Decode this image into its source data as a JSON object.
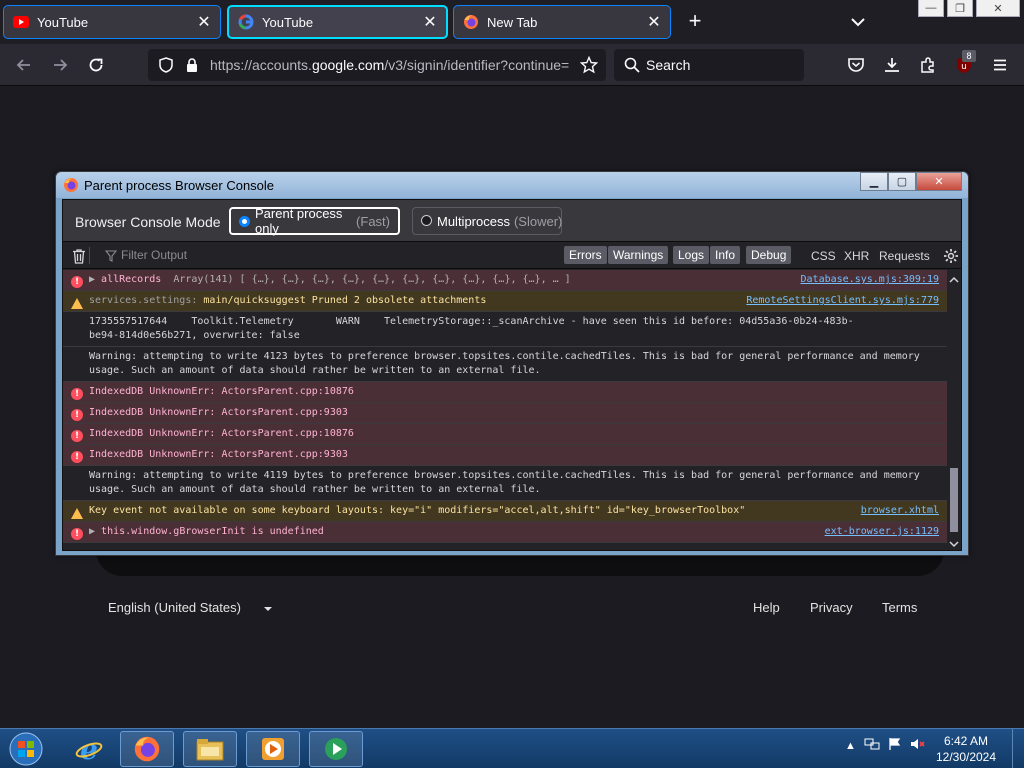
{
  "browser": {
    "tabs": [
      {
        "title": "YouTube",
        "icon": "youtube-icon"
      },
      {
        "title": "YouTube",
        "icon": "google-icon"
      },
      {
        "title": "New Tab",
        "icon": "firefox-icon"
      }
    ],
    "new_tab": "+",
    "url_prefix": "https://accounts.",
    "url_domain": "google.com",
    "url_suffix": "/v3/signin/identifier?continue=",
    "search_label": "Search",
    "extension_badge": "8"
  },
  "page": {
    "footer": {
      "language": "English (United States)",
      "help": "Help",
      "privacy": "Privacy",
      "terms": "Terms"
    }
  },
  "console": {
    "window_title": "Parent process Browser Console",
    "mode_label": "Browser Console Mode",
    "mode_parent": "Parent process only",
    "mode_parent_sub": "(Fast)",
    "mode_multi": "Multiprocess",
    "mode_multi_sub": "(Slower)",
    "filter_placeholder": "Filter Output",
    "filters": [
      "Errors",
      "Warnings",
      "Logs",
      "Info",
      "Debug"
    ],
    "extra_filters": [
      "CSS",
      "XHR",
      "Requests"
    ],
    "messages": [
      {
        "level": "err",
        "text": "allRecords",
        "extra": "Array(141) [ {…}, {…}, {…}, {…}, {…}, {…}, {…}, {…}, {…}, {…}, … ]",
        "source": "Database.sys.mjs:309:19"
      },
      {
        "level": "warn",
        "prefix": "services.settings:",
        "text": "main/quicksuggest Pruned 2 obsolete attachments",
        "source": "RemoteSettingsClient.sys.mjs:779"
      },
      {
        "level": "log",
        "line1": "1735557517644    Toolkit.Telemetry       WARN    TelemetryStorage::_scanArchive - have seen this id before: 04d55a36-0b24-483b-",
        "line2": "be94-814d0e56b271, overwrite: false"
      },
      {
        "level": "log",
        "line1": "Warning: attempting to write 4123 bytes to preference browser.topsites.contile.cachedTiles. This is bad for general performance and memory",
        "line2": "usage. Such an amount of data should rather be written to an external file."
      },
      {
        "level": "err",
        "text": "IndexedDB UnknownErr: ActorsParent.cpp:10876"
      },
      {
        "level": "err",
        "text": "IndexedDB UnknownErr: ActorsParent.cpp:9303"
      },
      {
        "level": "err",
        "text": "IndexedDB UnknownErr: ActorsParent.cpp:10876"
      },
      {
        "level": "err",
        "text": "IndexedDB UnknownErr: ActorsParent.cpp:9303"
      },
      {
        "level": "log",
        "line1": "Warning: attempting to write 4119 bytes to preference browser.topsites.contile.cachedTiles. This is bad for general performance and memory",
        "line2": "usage. Such an amount of data should rather be written to an external file."
      },
      {
        "level": "warn",
        "text": "Key event not available on some keyboard layouts: key=\"i\" modifiers=\"accel,alt,shift\" id=\"key_browserToolbox\"",
        "source": "browser.xhtml"
      },
      {
        "level": "err",
        "text": "this.window.gBrowserInit is undefined",
        "source": "ext-browser.js:1129"
      }
    ]
  },
  "taskbar": {
    "time": "6:42 AM",
    "date": "12/30/2024"
  },
  "colors": {
    "console_bg": "#232327",
    "error_row": "#4b2f36",
    "warn_row": "#42381f",
    "link": "#75bfff",
    "accent": "#0a84ff"
  }
}
